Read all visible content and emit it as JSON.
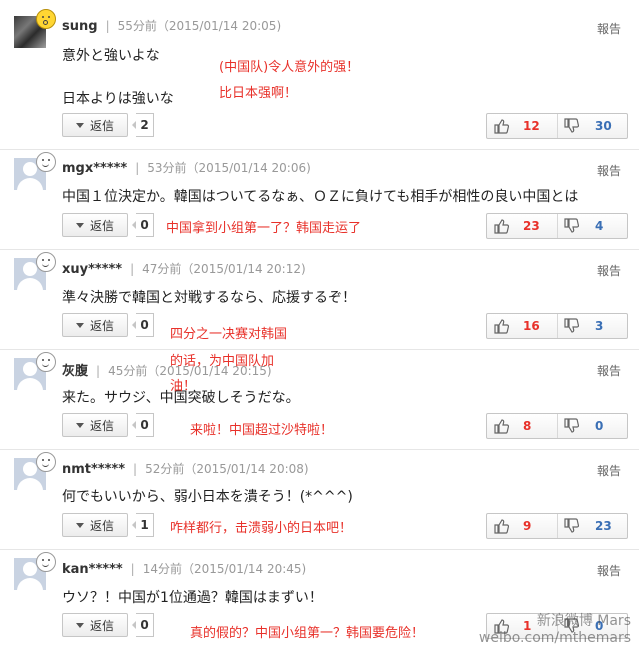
{
  "report_label": "報告",
  "reply_label": "返信",
  "comments": [
    {
      "user": "sung",
      "time": "55分前（2015/01/14 20:05)",
      "lines": [
        "意外と強いよな",
        "日本よりは強いな"
      ],
      "cn": [
        "(中国队)令人意外的强！",
        "比日本强啊！"
      ],
      "replies": "2",
      "up": "12",
      "down": "30"
    },
    {
      "user": "mgx*****",
      "time": "53分前（2015/01/14 20:06)",
      "lines": [
        "中国１位決定か。韓国はついてるなぁ、ＯＺに負けても相手が相性の良い中国とは"
      ],
      "cn": [
        "中国拿到小组第一了？韩国走运了"
      ],
      "replies": "0",
      "up": "23",
      "down": "4"
    },
    {
      "user": "xuy*****",
      "time": "47分前（2015/01/14 20:12)",
      "lines": [
        "準々決勝で韓国と対戦するなら、応援するぞ！"
      ],
      "cn": [
        "四分之一决赛对韩国",
        "的话，为中国队加",
        "油！"
      ],
      "replies": "0",
      "up": "16",
      "down": "3"
    },
    {
      "user": "灰腹",
      "time": "45分前（2015/01/14 20:15)",
      "lines": [
        "来た。サウジ、中国突破しそうだな。"
      ],
      "cn": [
        "来啦！中国超过沙特啦！"
      ],
      "replies": "0",
      "up": "8",
      "down": "0"
    },
    {
      "user": "nmt*****",
      "time": "52分前（2015/01/14 20:08)",
      "lines": [
        "何でもいいから、弱小日本を潰そう！(*^^^)"
      ],
      "cn": [
        "咋样都行，击溃弱小的日本吧！"
      ],
      "replies": "1",
      "up": "9",
      "down": "23"
    },
    {
      "user": "kan*****",
      "time": "14分前（2015/01/14 20:45)",
      "lines": [
        "ウソ？！中国が1位通過？韓国はまずい！"
      ],
      "cn": [
        "真的假的？中国小组第一？韩国要危险！"
      ],
      "replies": "0",
      "up": "1",
      "down": "0"
    }
  ],
  "watermark": {
    "line1": "新浪微博 Mars",
    "line2": "weibo.com/mthemars"
  }
}
